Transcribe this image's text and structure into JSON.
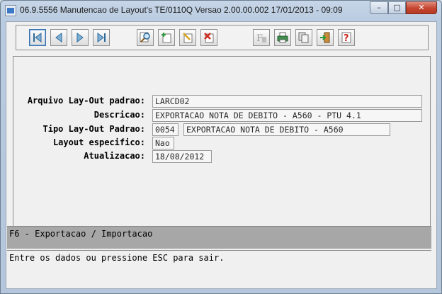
{
  "window": {
    "title": "06.9.5556 Manutencao  de Layout's TE/0110Q Versao 2.00.00.002 17/01/2013 - 09:09",
    "controls": {
      "minimize": "–",
      "maximize": "□",
      "close": "✕"
    }
  },
  "toolbar": {
    "buttons": [
      {
        "name": "first-record",
        "icon": "first-icon"
      },
      {
        "name": "previous-record",
        "icon": "previous-icon"
      },
      {
        "name": "next-record",
        "icon": "next-icon"
      },
      {
        "name": "last-record",
        "icon": "last-icon"
      },
      {
        "name": "search",
        "icon": "search-icon"
      },
      {
        "name": "add",
        "icon": "add-icon"
      },
      {
        "name": "edit",
        "icon": "edit-icon"
      },
      {
        "name": "delete",
        "icon": "delete-icon"
      },
      {
        "name": "filter",
        "icon": "filter-icon"
      },
      {
        "name": "print",
        "icon": "print-icon"
      },
      {
        "name": "copy",
        "icon": "copy-icon"
      },
      {
        "name": "exit",
        "icon": "exit-icon"
      },
      {
        "name": "help",
        "icon": "help-icon"
      }
    ]
  },
  "form": {
    "arquivo_label": "Arquivo Lay-Out padrao:",
    "arquivo_value": "LARCD02",
    "descricao_label": "Descricao:",
    "descricao_value": "EXPORTACAO NOTA DE DEBITO - A560 - PTU 4.1",
    "tipo_label": "Tipo Lay-Out Padrao:",
    "tipo_code": "0054",
    "tipo_desc": "EXPORTACAO NOTA DE DEBITO - A560",
    "especifico_label": "Layout especifico:",
    "especifico_value": "Nao",
    "atualizacao_label": "Atualizacao:",
    "atualizacao_value": "18/08/2012"
  },
  "fkeys": {
    "text": "F6 - Exportacao / Importacao"
  },
  "status": {
    "text": "Entre os dados ou pressione ESC para sair."
  },
  "colors": {
    "titlebar": "#c7d6e8",
    "close_button": "#c5452f",
    "fkey_bar": "#a7a7a7"
  }
}
